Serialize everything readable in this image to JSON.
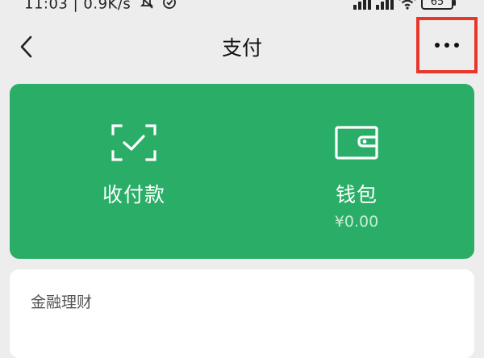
{
  "statusbar": {
    "time": "11:03",
    "network_speed": "0.9K/s",
    "battery": "65",
    "icons": [
      "mute-icon",
      "clock-icon",
      "signal-icon",
      "signal-icon",
      "wifi-icon",
      "battery-icon"
    ]
  },
  "header": {
    "title": "支付",
    "back_icon": "chevron-left-icon",
    "more_icon": "more-horizontal-icon"
  },
  "actions": {
    "receive_pay": {
      "label": "收付款",
      "icon": "scan-check-icon"
    },
    "wallet": {
      "label": "钱包",
      "balance": "¥0.00",
      "icon": "wallet-icon"
    }
  },
  "finance": {
    "title": "金融理财"
  },
  "colors": {
    "background": "#ededed",
    "card_green": "#2aae67",
    "highlight_red": "#e8362a",
    "panel": "#ffffff"
  }
}
